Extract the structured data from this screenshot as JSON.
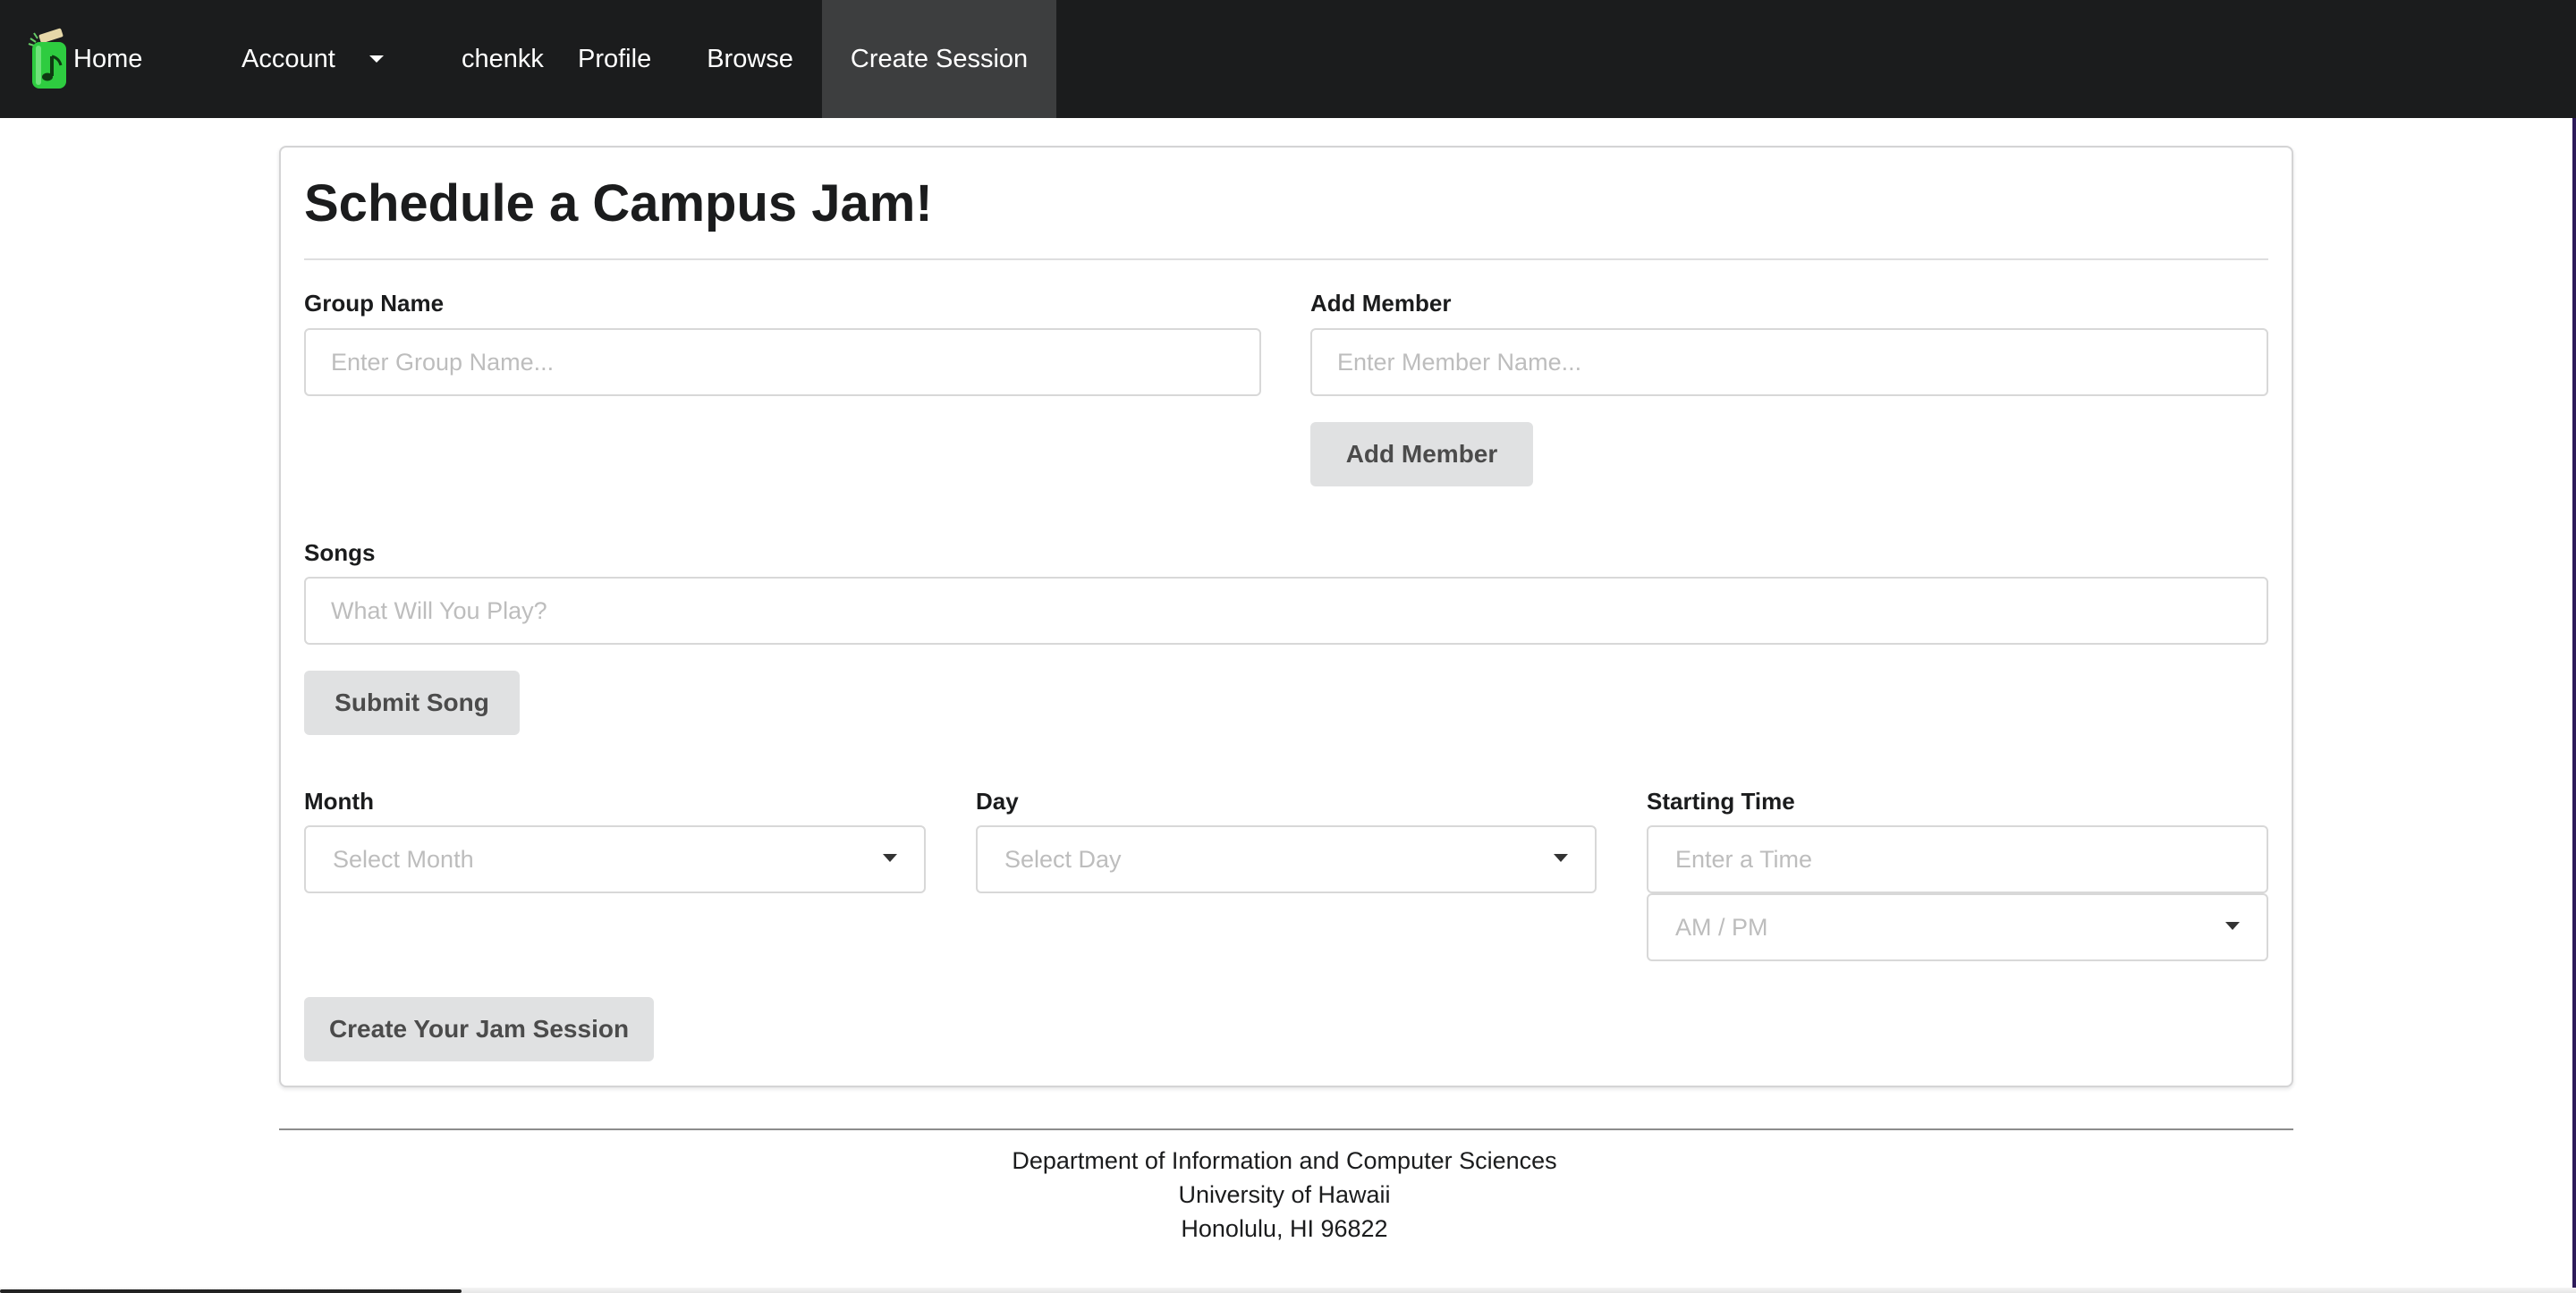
{
  "nav": {
    "home": "Home",
    "account": "Account",
    "username": "chenkk",
    "profile": "Profile",
    "browse": "Browse",
    "create_session": "Create Session"
  },
  "form": {
    "title": "Schedule a Campus Jam!",
    "group_name": {
      "label": "Group Name",
      "placeholder": "Enter Group Name...",
      "value": ""
    },
    "add_member": {
      "label": "Add Member",
      "placeholder": "Enter Member Name...",
      "value": "",
      "button": "Add Member"
    },
    "songs": {
      "label": "Songs",
      "placeholder": "What Will You Play?",
      "value": "",
      "button": "Submit Song"
    },
    "month": {
      "label": "Month",
      "placeholder": "Select Month"
    },
    "day": {
      "label": "Day",
      "placeholder": "Select Day"
    },
    "starting_time": {
      "label": "Starting Time",
      "placeholder": "Enter a Time",
      "ampm_placeholder": "AM / PM"
    },
    "submit_button": "Create Your Jam Session"
  },
  "footer": {
    "line1": "Department of Information and Computer Sciences",
    "line2": "University of Hawaii",
    "line3": "Honolulu, HI 96822"
  },
  "colors": {
    "navbar_bg": "#1b1c1d",
    "nav_active_bg": "#3d3e3f",
    "button_bg": "#e0e1e2",
    "logo_green": "#2ecc40"
  }
}
